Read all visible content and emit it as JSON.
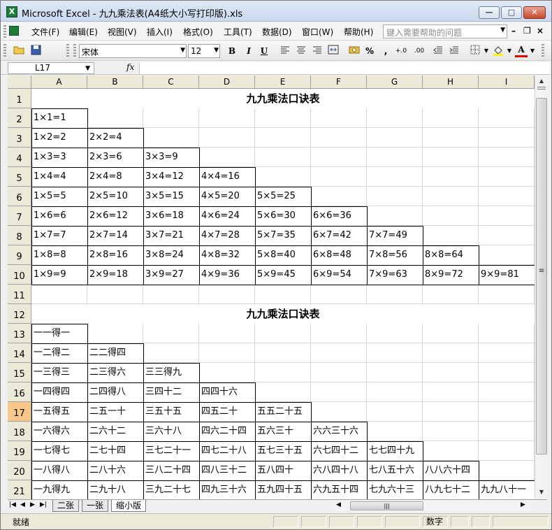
{
  "window": {
    "title": "Microsoft Excel - 九九乘法表(A4纸大小写打印版).xls",
    "app_icon": "excel-icon",
    "minimize": "—",
    "maximize": "□",
    "close": "✕"
  },
  "menubar": {
    "items": [
      "文件(F)",
      "编辑(E)",
      "视图(V)",
      "插入(I)",
      "格式(O)",
      "工具(T)",
      "数据(D)",
      "窗口(W)",
      "帮助(H)"
    ],
    "help_placeholder": "键入需要帮助的问题",
    "doc_minimize": "–",
    "doc_restore": "❐",
    "doc_close": "×"
  },
  "toolbar": {
    "open_icon": "folder-open-icon",
    "save_icon": "floppy-save-icon",
    "font_name": "宋体",
    "font_size": "12",
    "bold": "B",
    "italic": "I",
    "underline": "U",
    "percent": "%",
    "comma": ",",
    "inc_decimal": "+.0",
    "dec_decimal": ".00",
    "font_color": "A"
  },
  "formula_bar": {
    "name_box": "L17",
    "fx": "fx",
    "formula": ""
  },
  "columns": [
    "A",
    "B",
    "C",
    "D",
    "E",
    "F",
    "G",
    "H",
    "I"
  ],
  "rows": [
    "1",
    "2",
    "3",
    "4",
    "5",
    "6",
    "7",
    "8",
    "9",
    "10",
    "11",
    "12",
    "13",
    "14",
    "15",
    "16",
    "17",
    "18",
    "19",
    "20",
    "21"
  ],
  "selected_row": "17",
  "sheet": {
    "title_top": "九九乘法口诀表",
    "title_bottom": "九九乘法口诀表",
    "arabic": [
      [
        "1×1=1"
      ],
      [
        "1×2=2",
        "2×2=4"
      ],
      [
        "1×3=3",
        "2×3=6",
        "3×3=9"
      ],
      [
        "1×4=4",
        "2×4=8",
        "3×4=12",
        "4×4=16"
      ],
      [
        "1×5=5",
        "2×5=10",
        "3×5=15",
        "4×5=20",
        "5×5=25"
      ],
      [
        "1×6=6",
        "2×6=12",
        "3×6=18",
        "4×6=24",
        "5×6=30",
        "6×6=36"
      ],
      [
        "1×7=7",
        "2×7=14",
        "3×7=21",
        "4×7=28",
        "5×7=35",
        "6×7=42",
        "7×7=49"
      ],
      [
        "1×8=8",
        "2×8=16",
        "3×8=24",
        "4×8=32",
        "5×8=40",
        "6×8=48",
        "7×8=56",
        "8×8=64"
      ],
      [
        "1×9=9",
        "2×9=18",
        "3×9=27",
        "4×9=36",
        "5×9=45",
        "6×9=54",
        "7×9=63",
        "8×9=72",
        "9×9=81"
      ]
    ],
    "chinese": [
      [
        "一一得一"
      ],
      [
        "一二得二",
        "二二得四"
      ],
      [
        "一三得三",
        "二三得六",
        "三三得九"
      ],
      [
        "一四得四",
        "二四得八",
        "三四十二",
        "四四十六"
      ],
      [
        "一五得五",
        "二五一十",
        "三五十五",
        "四五二十",
        "五五二十五"
      ],
      [
        "一六得六",
        "二六十二",
        "三六十八",
        "四六二十四",
        "五六三十",
        "六六三十六"
      ],
      [
        "一七得七",
        "二七十四",
        "三七二十一",
        "四七二十八",
        "五七三十五",
        "六七四十二",
        "七七四十九"
      ],
      [
        "一八得八",
        "二八十六",
        "三八二十四",
        "四八三十二",
        "五八四十",
        "六八四十八",
        "七八五十六",
        "八八六十四"
      ],
      [
        "一九得九",
        "二九十八",
        "三九二十七",
        "四九三十六",
        "五九四十五",
        "六九五十四",
        "七九六十三",
        "八九七十二",
        "九九八十一"
      ]
    ]
  },
  "tabs": [
    "二张",
    "一张",
    "缩小版"
  ],
  "active_tab": 2,
  "status": {
    "ready": "就绪",
    "num_lock": "数字"
  },
  "colors": {
    "title_gradient_top": "#dfe9f5",
    "header_bg": "#ece9d8",
    "selected_row_header": "#f8c78a",
    "excel_green": "#1f7b3a"
  }
}
